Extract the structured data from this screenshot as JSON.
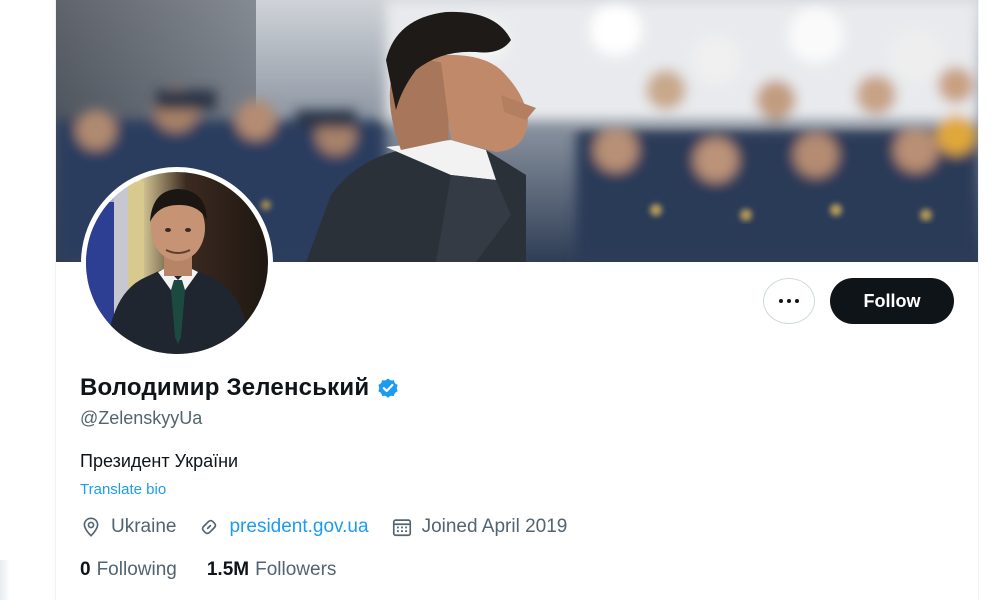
{
  "profile": {
    "display_name": "Володимир Зеленський",
    "handle": "@ZelenskyyUa",
    "bio": "Президент України",
    "translate_label": "Translate bio",
    "verified": true
  },
  "actions": {
    "more_icon": "more-horizontal-icon",
    "follow_label": "Follow"
  },
  "meta": {
    "location": "Ukraine",
    "location_icon": "location-pin-icon",
    "website": "president.gov.ua",
    "website_icon": "link-icon",
    "joined": "Joined April 2019",
    "joined_icon": "calendar-icon"
  },
  "stats": {
    "following_count": "0",
    "following_label": "Following",
    "followers_count": "1.5M",
    "followers_label": "Followers"
  },
  "colors": {
    "accent": "#1d9bf0",
    "text_primary": "#0f1419",
    "text_secondary": "#536471",
    "button_dark": "#0f1419"
  }
}
